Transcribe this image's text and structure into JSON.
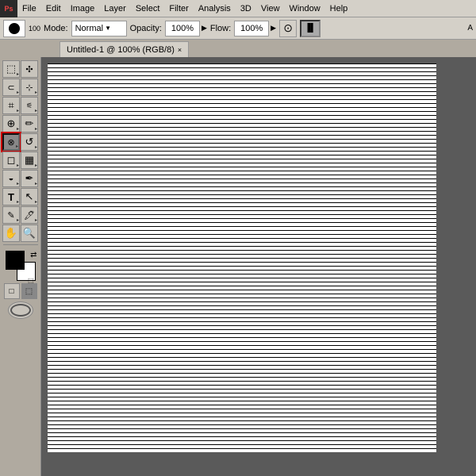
{
  "menubar": {
    "logo": "Ps",
    "items": [
      "File",
      "Edit",
      "Image",
      "Layer",
      "Select",
      "Filter",
      "Analysis",
      "3D",
      "View",
      "Window",
      "Help"
    ]
  },
  "optionsbar": {
    "brush_size": "100",
    "mode_label": "Mode:",
    "mode_value": "Normal",
    "opacity_label": "Opacity:",
    "opacity_value": "100%",
    "flow_label": "Flow:",
    "flow_value": "100%",
    "airbrush_active": false
  },
  "tabbar": {
    "tab_title": "Untitled-1 @ 100% (RGB/8)",
    "close_symbol": "×"
  },
  "toolbar": {
    "tools": [
      {
        "id": "move",
        "icon": "✣",
        "active": false
      },
      {
        "id": "lasso",
        "icon": "⬡",
        "active": false
      },
      {
        "id": "crop",
        "icon": "⌗",
        "active": false
      },
      {
        "id": "spot-heal",
        "icon": "⊕",
        "active": false
      },
      {
        "id": "brush",
        "icon": "✏",
        "active": false
      },
      {
        "id": "clone",
        "icon": "⊗",
        "active": false
      },
      {
        "id": "history",
        "icon": "↺",
        "active": false
      },
      {
        "id": "eraser",
        "icon": "◻",
        "active": false
      },
      {
        "id": "gradient",
        "icon": "▦",
        "active": false
      },
      {
        "id": "dodge",
        "icon": "◯",
        "active": false
      },
      {
        "id": "pen",
        "icon": "✒",
        "active": false
      },
      {
        "id": "type",
        "icon": "T",
        "active": false
      },
      {
        "id": "path-select",
        "icon": "↖",
        "active": false
      },
      {
        "id": "shape",
        "icon": "■",
        "active": false
      },
      {
        "id": "notes",
        "icon": "✎",
        "active": false
      },
      {
        "id": "eyedropper",
        "icon": "🖊",
        "active": false
      },
      {
        "id": "hand",
        "icon": "✋",
        "active": false
      },
      {
        "id": "zoom",
        "icon": "🔍",
        "active": false
      },
      {
        "id": "smudge",
        "icon": "◈",
        "active": true
      }
    ],
    "fg_color": "#000000",
    "bg_color": "#ffffff"
  },
  "canvas": {
    "title": "Untitled-1",
    "zoom": "100%",
    "mode": "RGB/8"
  }
}
